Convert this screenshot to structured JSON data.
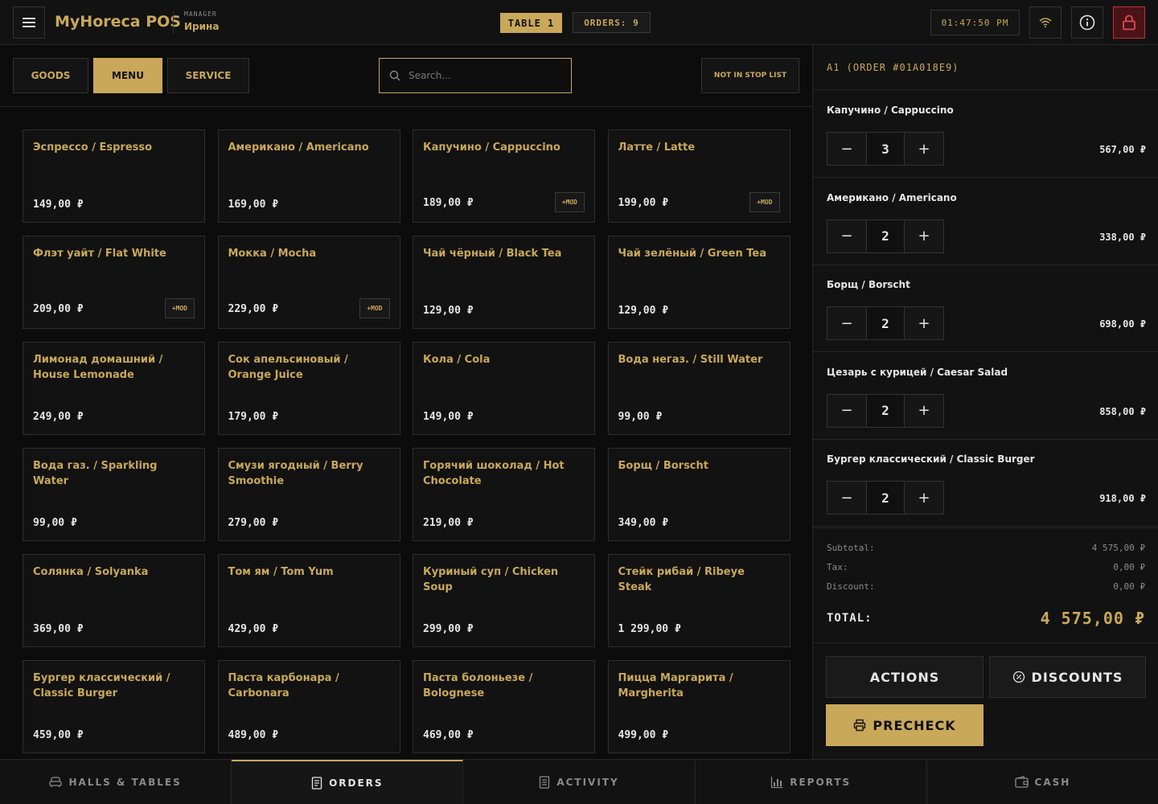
{
  "header": {
    "brand": "MyHoreca POS",
    "role": "MANAGER",
    "user": "Ирина",
    "table": "TABLE 1",
    "orders": "ORDERS: 9",
    "time": "01:47:50 PM"
  },
  "categories": {
    "goods": "GOODS",
    "menu": "MENU",
    "service": "SERVICE",
    "active": "MENU"
  },
  "search": {
    "placeholder": "Search..."
  },
  "stop_list": "NOT IN STOP LIST",
  "menu_items": [
    {
      "name": "Эспрессо / Espresso",
      "price": "149,00 ₽",
      "mod": ""
    },
    {
      "name": "Американо / Americano",
      "price": "169,00 ₽",
      "mod": ""
    },
    {
      "name": "Капучино / Cappuccino",
      "price": "189,00 ₽",
      "mod": "+MOD"
    },
    {
      "name": "Латте / Latte",
      "price": "199,00 ₽",
      "mod": "+MOD"
    },
    {
      "name": "Флэт уайт / Flat White",
      "price": "209,00 ₽",
      "mod": "+MOD"
    },
    {
      "name": "Мокка / Mocha",
      "price": "229,00 ₽",
      "mod": "+MOD"
    },
    {
      "name": "Чай чёрный / Black Tea",
      "price": "129,00 ₽",
      "mod": ""
    },
    {
      "name": "Чай зелёный / Green Tea",
      "price": "129,00 ₽",
      "mod": ""
    },
    {
      "name": "Лимонад домашний / House Lemonade",
      "price": "249,00 ₽",
      "mod": ""
    },
    {
      "name": "Сок апельсиновый / Orange Juice",
      "price": "179,00 ₽",
      "mod": ""
    },
    {
      "name": "Кола / Cola",
      "price": "149,00 ₽",
      "mod": ""
    },
    {
      "name": "Вода негаз. / Still Water",
      "price": "99,00 ₽",
      "mod": ""
    },
    {
      "name": "Вода газ. / Sparkling Water",
      "price": "99,00 ₽",
      "mod": ""
    },
    {
      "name": "Смузи ягодный / Berry Smoothie",
      "price": "279,00 ₽",
      "mod": ""
    },
    {
      "name": "Горячий шоколад / Hot Chocolate",
      "price": "219,00 ₽",
      "mod": ""
    },
    {
      "name": "Борщ / Borscht",
      "price": "349,00 ₽",
      "mod": ""
    },
    {
      "name": "Солянка / Solyanka",
      "price": "369,00 ₽",
      "mod": ""
    },
    {
      "name": "Том ям / Tom Yum",
      "price": "429,00 ₽",
      "mod": ""
    },
    {
      "name": "Куриный суп / Chicken Soup",
      "price": "299,00 ₽",
      "mod": ""
    },
    {
      "name": "Стейк рибай / Ribeye Steak",
      "price": "1 299,00 ₽",
      "mod": ""
    },
    {
      "name": "Бургер классический / Classic Burger",
      "price": "459,00 ₽",
      "mod": ""
    },
    {
      "name": "Паста карбонара / Carbonara",
      "price": "489,00 ₽",
      "mod": ""
    },
    {
      "name": "Паста болоньезе / Bolognese",
      "price": "469,00 ₽",
      "mod": ""
    },
    {
      "name": "Пицца Маргарита / Margherita",
      "price": "499,00 ₽",
      "mod": ""
    }
  ],
  "order": {
    "title": "A1 (ORDER #01A018E9)",
    "lines": [
      {
        "name": "Капучино / Cappuccino",
        "qty": "3",
        "total": "567,00 ₽"
      },
      {
        "name": "Американо / Americano",
        "qty": "2",
        "total": "338,00 ₽"
      },
      {
        "name": "Борщ / Borscht",
        "qty": "2",
        "total": "698,00 ₽"
      },
      {
        "name": "Цезарь с курицей / Caesar Salad",
        "qty": "2",
        "total": "858,00 ₽"
      },
      {
        "name": "Бургер классический / Classic Burger",
        "qty": "2",
        "total": "918,00 ₽"
      }
    ],
    "subtotal_label": "Subtotal:",
    "subtotal": "4 575,00 ₽",
    "tax_label": "Tax:",
    "tax": "0,00 ₽",
    "discount_label": "Discount:",
    "discount": "0,00 ₽",
    "total_label": "TOTAL:",
    "total": "4 575,00 ₽",
    "qty_minus": "−",
    "qty_plus": "+"
  },
  "actions": {
    "actions": "ACTIONS",
    "discounts": "DISCOUNTS",
    "precheck": "PRECHECK"
  },
  "nav": {
    "halls": "HALLS & TABLES",
    "orders": "ORDERS",
    "activity": "ACTIVITY",
    "reports": "REPORTS",
    "cash": "CASH",
    "active": "ORDERS"
  },
  "colors": {
    "accent": "#c9a85a",
    "background": "#0d0d0d",
    "lock": "#c0303a"
  }
}
